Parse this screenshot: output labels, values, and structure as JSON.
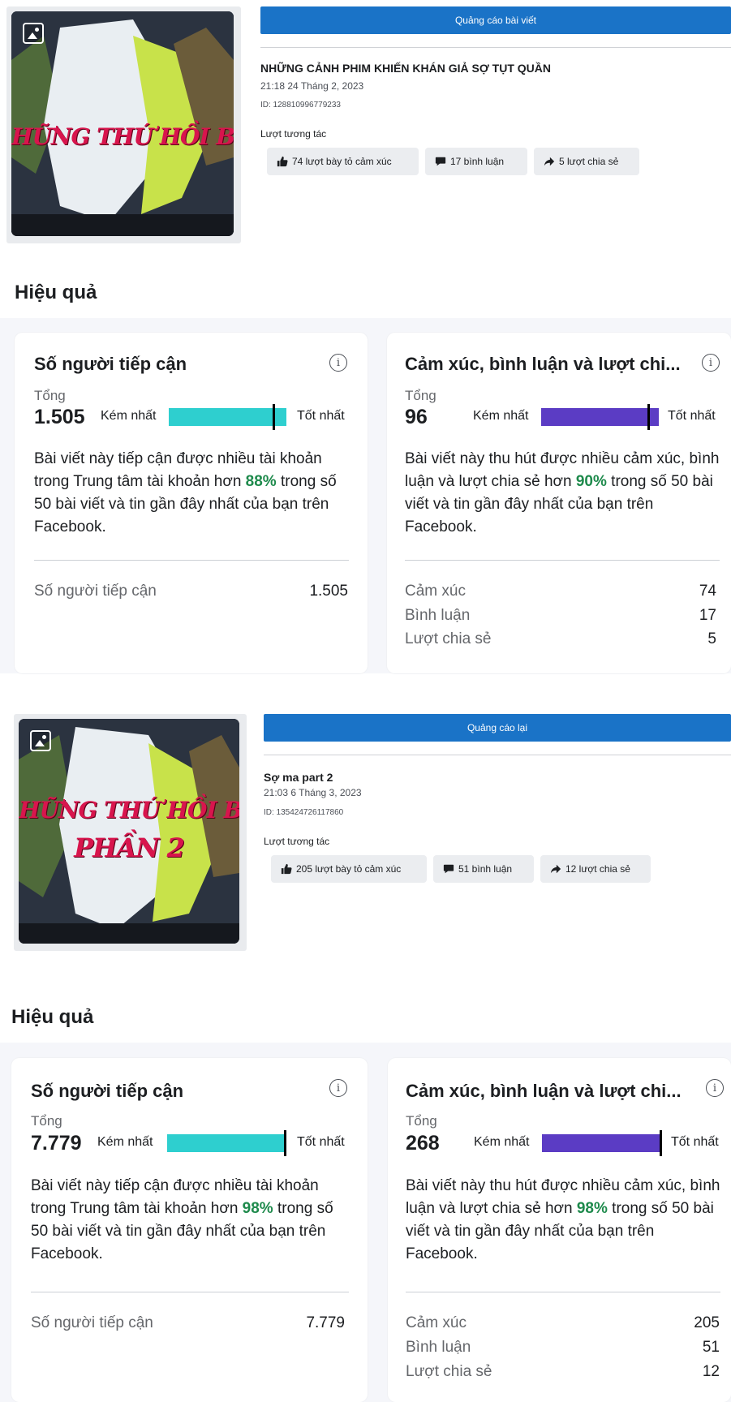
{
  "posts": [
    {
      "promo_label": "Quảng cáo bài viết",
      "title": "NHỮNG CẢNH PHIM KHIẾN KHÁN GIẢ SỢ TỤT QUẦN",
      "date": "21:18 24 Tháng 2, 2023",
      "id": "ID: 128810996779233",
      "interactions_label": "Lượt tương tác",
      "thumb_caption": "HỮNG THỨ HỒI BÉ SỢ VL S",
      "thumb_caption2": "",
      "chips": {
        "reactions": "74 lượt bày tỏ cảm xúc",
        "comments": "17 bình luận",
        "shares": "5 lượt chia sẻ"
      },
      "section_title": "Hiệu quả",
      "reach": {
        "title": "Số người tiếp cận",
        "total_label": "Tổng",
        "total": "1.505",
        "low": "Kém nhất",
        "high": "Tốt nhất",
        "level": 0.88,
        "desc_before": "Bài viết này tiếp cận được nhiều tài khoản trong Trung tâm tài khoản hơn ",
        "pct": "88%",
        "desc_after": " trong số 50 bài viết và tin gần đây nhất của bạn trên Facebook.",
        "metric_label": "Số người tiếp cận",
        "metric_value": "1.505"
      },
      "engagement": {
        "title": "Cảm xúc, bình luận và lượt chi...",
        "total_label": "Tổng",
        "total": "96",
        "low": "Kém nhất",
        "high": "Tốt nhất",
        "level": 0.9,
        "desc_before": "Bài viết này thu hút được nhiều cảm xúc, bình luận và lượt chia sẻ hơn ",
        "pct": "90%",
        "desc_after": " trong số 50 bài viết và tin gần đây nhất của bạn trên Facebook.",
        "rows": [
          {
            "label": "Cảm xúc",
            "value": "74"
          },
          {
            "label": "Bình luận",
            "value": "17"
          },
          {
            "label": "Lượt chia sẻ",
            "value": "5"
          }
        ]
      }
    },
    {
      "promo_label": "Quảng cáo lại",
      "title": "Sợ ma part 2",
      "date": "21:03 6 Tháng 3, 2023",
      "id": "ID: 135424726117860",
      "interactions_label": "Lượt tương tác",
      "thumb_caption": "HỮNG THỨ HỒI BÉ SỢ VL S",
      "thumb_caption2": "PHẦN 2",
      "chips": {
        "reactions": "205 lượt bày tỏ cảm xúc",
        "comments": "51 bình luận",
        "shares": "12 lượt chia sẻ"
      },
      "section_title": "Hiệu quả",
      "reach": {
        "title": "Số người tiếp cận",
        "total_label": "Tổng",
        "total": "7.779",
        "low": "Kém nhất",
        "high": "Tốt nhất",
        "level": 0.98,
        "desc_before": "Bài viết này tiếp cận được nhiều tài khoản trong Trung tâm tài khoản hơn ",
        "pct": "98%",
        "desc_after": " trong số 50 bài viết và tin gần đây nhất của bạn trên Facebook.",
        "metric_label": "Số người tiếp cận",
        "metric_value": "7.779"
      },
      "engagement": {
        "title": "Cảm xúc, bình luận và lượt chi...",
        "total_label": "Tổng",
        "total": "268",
        "low": "Kém nhất",
        "high": "Tốt nhất",
        "level": 0.98,
        "desc_before": "Bài viết này thu hút được nhiều cảm xúc, bình luận và lượt chia sẻ hơn ",
        "pct": "98%",
        "desc_after": " trong số 50 bài viết và tin gần đây nhất của bạn trên Facebook.",
        "rows": [
          {
            "label": "Cảm xúc",
            "value": "205"
          },
          {
            "label": "Bình luận",
            "value": "51"
          },
          {
            "label": "Lượt chia sẻ",
            "value": "12"
          }
        ]
      }
    }
  ],
  "colors": {
    "promo": "#1a73c7",
    "reach_bar": "#2ecfcf",
    "engagement_bar": "#5b3cc4",
    "pct_text": "#1e8a4c"
  },
  "icons": [
    "media-icon",
    "thumbs-up-icon",
    "comment-icon",
    "share-icon",
    "info-icon"
  ]
}
